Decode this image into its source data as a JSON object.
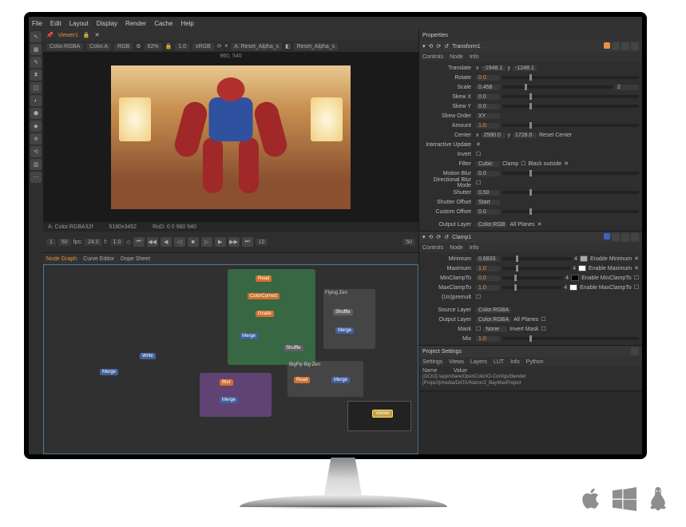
{
  "menu": [
    "File",
    "Edit",
    "Layout",
    "Display",
    "Render",
    "Cache",
    "Help"
  ],
  "viewer": {
    "tab": "Viewer1",
    "layerA": "Color.RGBA",
    "colorA": "Color.A",
    "rgb": "RGB",
    "zoom": "62%",
    "fit": "1.0",
    "srgb": "sRGB",
    "inputA": "Reset_Alpha_s",
    "inputB": "Reset_Alpha_s",
    "ab": "A",
    "res_overlay": "960, 540",
    "info_left": "A: Color.RGBA32f",
    "info_res": "5180x3452",
    "info_rod": "RoD: 0 0 960 540",
    "timeline": {
      "start": "1",
      "fps_lbl": "fps:",
      "fps": "24.0",
      "fit_lbl": "f:",
      "fit": "1.0",
      "cur": "10",
      "end": "50"
    }
  },
  "nodegraph": {
    "tabs": [
      "Node Graph",
      "Curve Editor",
      "Dope Sheet"
    ],
    "nodes": {
      "read1": "Read",
      "color1": "ColorCorrect",
      "grade1": "Grade",
      "merge1": "Merge",
      "blur1": "Blur",
      "shuffle1": "Shuffle",
      "write1": "Write",
      "viewer1": "Viewer",
      "bg_fog": "Flying Zen",
      "bigfly": "BigFly Big Zen"
    }
  },
  "properties": {
    "title": "Properties",
    "transform": {
      "title": "Transform1",
      "tabs": [
        "Controls",
        "Node",
        "Info"
      ],
      "translate_lbl": "Translate",
      "tx": "-1948.1",
      "ty_lbl": "y",
      "ty": "-1248.1",
      "rotate_lbl": "Rotate",
      "rotate": "0.0",
      "scale_lbl": "Scale",
      "scale": "0.458",
      "scale_link": "2",
      "skewx_lbl": "Skew X",
      "skewx": "0.0",
      "skewy_lbl": "Skew Y",
      "skewy": "0.0",
      "skeworder_lbl": "Skew Order",
      "skeworder": "XY",
      "amount_lbl": "Amount",
      "amount": "1.0",
      "center_lbl": "Center",
      "cx": "2590.0",
      "cy_lbl": "y",
      "cy": "1728.0",
      "reset_center": "Reset Center",
      "interactive_lbl": "Interactive Update",
      "invert_lbl": "Invert",
      "filter_lbl": "Filter",
      "filter": "Cubic",
      "clamp": "Clamp",
      "black_outside": "Black outside",
      "motion_blur_lbl": "Motion Blur",
      "motion_blur": "0.0",
      "dir_blur_lbl": "Directional Blur Mode",
      "shutter_lbl": "Shutter",
      "shutter": "0.50",
      "shutter_off_lbl": "Shutter Offset",
      "shutter_off": "Start",
      "custom_off_lbl": "Custom Offset",
      "custom_off": "0.0",
      "output_layer_lbl": "Output Layer",
      "output_layer": "Color.RGB",
      "all_planes": "All Planes"
    },
    "clamp": {
      "title": "Clamp1",
      "tabs": [
        "Controls",
        "Node",
        "Info"
      ],
      "min_lbl": "Minimum",
      "min": "0.6833",
      "enable_min": "Enable Minimum",
      "max_lbl": "Maximum",
      "max": "1.0",
      "enable_max": "Enable Maximum",
      "minclamp_lbl": "MinClampTo",
      "minclamp": "0.0",
      "enable_minclamp": "Enable MinClampTo",
      "maxclamp_lbl": "MaxClampTo",
      "maxclamp": "1.0",
      "enable_maxclamp": "Enable MaxClampTo",
      "unpremult_lbl": "(Un)premult",
      "source_lbl": "Source Layer",
      "source": "Color.RGBA",
      "output_lbl": "Output Layer",
      "output": "Color.RGBA",
      "all_planes": "All Planes",
      "mask_lbl": "Mask",
      "mask": "None",
      "invert_mask": "Invert Mask",
      "mix_lbl": "Mix",
      "mix": "1.0"
    }
  },
  "settings": {
    "title": "Project Settings",
    "tabs": [
      "Settings",
      "Views",
      "Layers",
      "LUT",
      "Info",
      "Python"
    ],
    "name_hdr": "Name",
    "value_hdr": "Value",
    "ocio_name": "[OCIO]",
    "ocio_val": "/app/share/OpenColorIO-Configs/blender",
    "proj_name": "[Project]",
    "proj_val": "/media/DATA/Natron2_BayMaxProject"
  },
  "os": {
    "apple": "apple-icon",
    "windows": "windows-icon",
    "linux": "linux-icon"
  }
}
